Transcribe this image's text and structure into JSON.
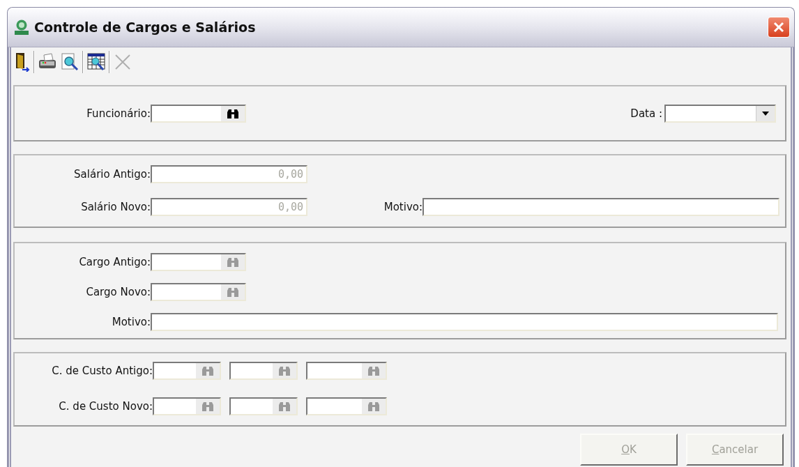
{
  "window": {
    "title": "Controle de Cargos e Salários"
  },
  "toolbar": [
    {
      "kind": "exit",
      "disabled": false
    },
    {
      "kind": "separator"
    },
    {
      "kind": "print",
      "disabled": false
    },
    {
      "kind": "preview",
      "disabled": false
    },
    {
      "kind": "separator"
    },
    {
      "kind": "grid-search",
      "disabled": false
    },
    {
      "kind": "separator"
    },
    {
      "kind": "delete",
      "disabled": true
    }
  ],
  "header": {
    "employee": {
      "label": "Funcionário:",
      "lookup_disabled": false
    },
    "date": {
      "label": "Data :"
    }
  },
  "salary": {
    "old": {
      "label": "Salário Antigo:",
      "value": "0,00",
      "disabled": true
    },
    "new": {
      "label": "Salário Novo:",
      "value": "0,00",
      "disabled": true
    },
    "reason": {
      "label": "Motivo:"
    }
  },
  "position": {
    "old": {
      "label": "Cargo Antigo:",
      "lookup_disabled": true
    },
    "new": {
      "label": "Cargo Novo:",
      "lookup_disabled": true
    },
    "reason": {
      "label": "Motivo:"
    }
  },
  "cost_center": [
    {
      "label": "C. de Custo Antigo:",
      "fields": [
        {
          "lookup_disabled": true
        },
        {
          "lookup_disabled": true
        },
        {
          "lookup_disabled": true
        }
      ]
    },
    {
      "label": "C. de Custo Novo:",
      "fields": [
        {
          "lookup_disabled": true
        },
        {
          "lookup_disabled": true
        },
        {
          "lookup_disabled": true
        }
      ]
    }
  ],
  "buttons": [
    {
      "label": "OK",
      "disabled": true
    },
    {
      "label": "Cancelar",
      "disabled": true
    }
  ]
}
